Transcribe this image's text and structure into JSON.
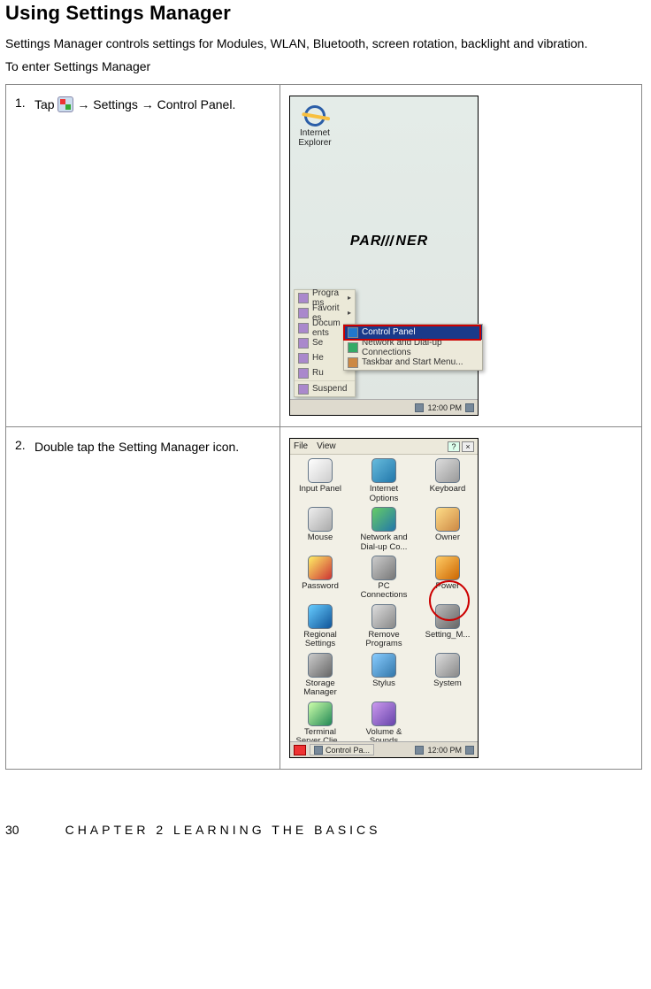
{
  "heading": "Using Settings Manager",
  "intro": "Settings Manager controls settings for Modules, WLAN, Bluetooth, screen rotation, backlight and vibration.",
  "sub": "To enter Settings Manager",
  "steps": {
    "s1_num": "1.",
    "s1_a": "Tap ",
    "s1_b": " → Settings → Control Panel.",
    "s2_num": "2.",
    "s2": "Double tap the Setting Manager icon."
  },
  "scr1": {
    "ie_label": "Internet Explorer",
    "partner_a": "PAR",
    "partner_b": "NER",
    "menu": {
      "programs": "Programs",
      "favorites": "Favorites",
      "documents": "Documents",
      "settings_short": "Se",
      "help_short": "He",
      "run_short": "Ru",
      "suspend": "Suspend"
    },
    "submenu": {
      "control_panel": "Control Panel",
      "network": "Network and Dial-up Connections",
      "taskbar": "Taskbar and Start Menu..."
    },
    "taskbar_time": "12:00 PM"
  },
  "scr2": {
    "menubar": {
      "file": "File",
      "view": "View"
    },
    "items": {
      "input_panel": "Input Panel",
      "internet_options": "Internet Options",
      "keyboard": "Keyboard",
      "mouse": "Mouse",
      "network": "Network and Dial-up Co...",
      "owner": "Owner",
      "password": "Password",
      "pc_connections": "PC Connections",
      "power": "Power",
      "regional": "Regional Settings",
      "remove": "Remove Programs",
      "setting_m": "Setting_M...",
      "storage": "Storage Manager",
      "stylus": "Stylus",
      "system": "System",
      "terminal": "Terminal Server Clie...",
      "volume": "Volume & Sounds"
    },
    "taskbar_task": "Control Pa...",
    "taskbar_time": "12:00 PM"
  },
  "footer": {
    "page": "30",
    "chapter": "CHAPTER 2 LEARNING THE BASICS"
  }
}
